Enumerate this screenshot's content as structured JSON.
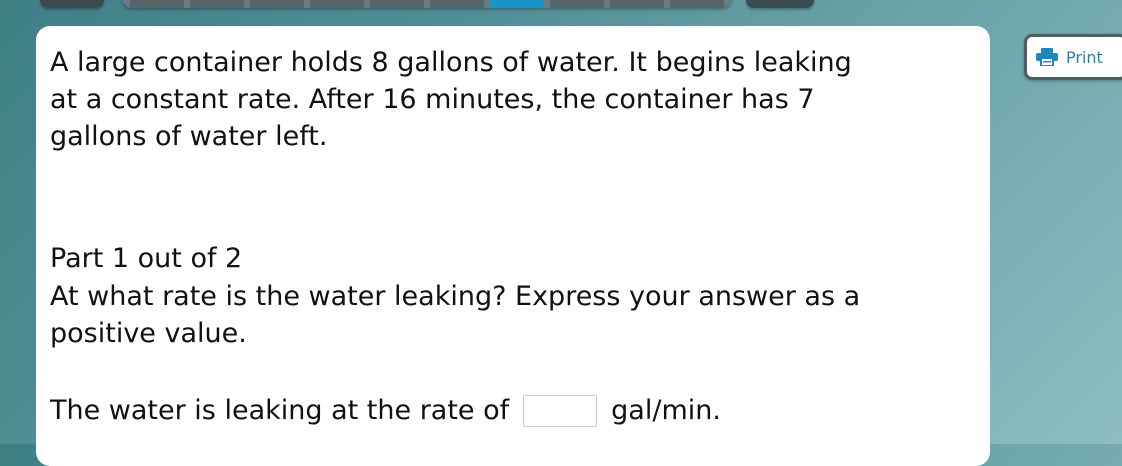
{
  "problem": {
    "text": "A large container holds 8 gallons of water. It begins leaking at a constant rate. After 16 minutes, the container has 7 gallons of water left."
  },
  "part": {
    "label": "Part 1 out of 2",
    "question": "At what rate is the water leaking? Express your answer as a positive value."
  },
  "answer": {
    "prefix": "The water is leaking at the rate of",
    "value": "",
    "unit": "gal/min."
  },
  "toolbar": {
    "print_label": "Print",
    "print_icon": "printer-icon"
  },
  "colors": {
    "accent": "#1795c9",
    "print_text": "#2a7fb0",
    "nav_dark": "#3c4b50"
  }
}
